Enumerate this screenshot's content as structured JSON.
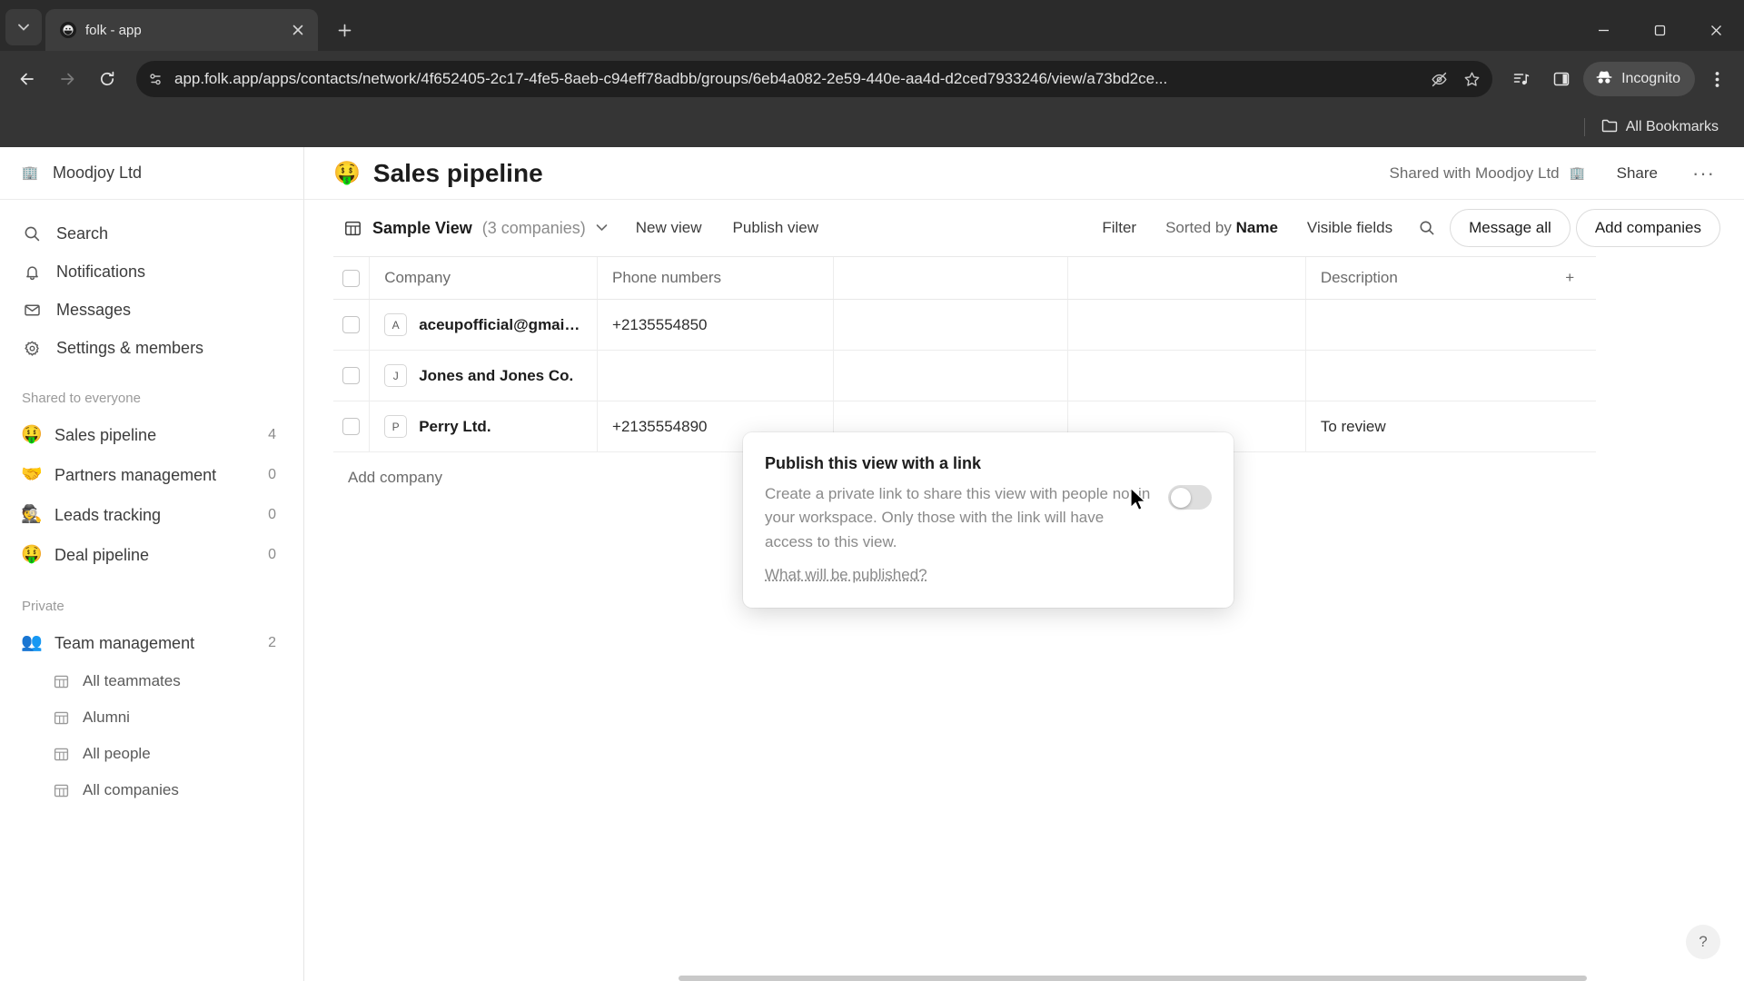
{
  "browser": {
    "tab": {
      "title": "folk - app",
      "favicon": "folk-favicon-icon",
      "close_label": "×"
    },
    "new_tab_label": "+",
    "window": {
      "minimize": "—",
      "maximize": "❐",
      "close": "✕"
    },
    "nav": {
      "back": "←",
      "forward": "→",
      "reload": "↻"
    },
    "omnibox": {
      "url": "app.folk.app/apps/contacts/network/4f652405-2c17-4fe5-8aeb-c94eff78adbb/groups/6eb4a082-2e59-440e-aa4d-d2ced7933246/view/a73bd2ce...",
      "site_info_icon": "tune-icon",
      "tracking_icon": "eye-off-icon",
      "bookmark_icon": "star-icon"
    },
    "toolbar_icons": {
      "media": "media-control-icon",
      "side_panel": "side-panel-icon",
      "menu": "kebab-menu-icon"
    },
    "incognito": {
      "label": "Incognito",
      "icon": "incognito-hat-icon"
    },
    "bookmarks": {
      "all_label": "All Bookmarks",
      "folder_icon": "folder-icon"
    }
  },
  "sidebar": {
    "workspace": {
      "name": "Moodjoy Ltd",
      "avatar": "🏢"
    },
    "nav": [
      {
        "label": "Search",
        "icon": "search-icon"
      },
      {
        "label": "Notifications",
        "icon": "bell-icon"
      },
      {
        "label": "Messages",
        "icon": "envelope-icon"
      },
      {
        "label": "Settings & members",
        "icon": "gear-icon"
      }
    ],
    "shared_group_label": "Shared to everyone",
    "shared_items": [
      {
        "label": "Sales pipeline",
        "emoji": "🤑",
        "count": "4"
      },
      {
        "label": "Partners management",
        "emoji": "🤝",
        "count": "0"
      },
      {
        "label": "Leads tracking",
        "emoji": "🕵️",
        "count": "0"
      },
      {
        "label": "Deal pipeline",
        "emoji": "🤑",
        "count": "0"
      }
    ],
    "private_group_label": "Private",
    "private_items": [
      {
        "label": "Team management",
        "emoji": "👥",
        "count": "2"
      }
    ],
    "sub_items": [
      {
        "label": "All teammates",
        "icon": "table-view-icon"
      },
      {
        "label": "Alumni",
        "icon": "table-view-icon"
      },
      {
        "label": "All people",
        "icon": "table-view-icon"
      },
      {
        "label": "All companies",
        "icon": "table-view-icon"
      }
    ]
  },
  "page": {
    "title": "Sales pipeline",
    "emoji": "🤑",
    "shared_with": "Shared with Moodjoy Ltd",
    "shared_avatar": "🏢",
    "share_label": "Share",
    "more_label": "···"
  },
  "toolbar": {
    "view_icon": "table-view-icon",
    "view_name": "Sample View",
    "view_count": "(3 companies)",
    "view_chevron": "chevron-down-icon",
    "new_view_label": "New view",
    "publish_view_label": "Publish view",
    "filter_label": "Filter",
    "sorted_by_prefix": "Sorted by",
    "sorted_by_field": "Name",
    "visible_fields_label": "Visible fields",
    "search_icon": "search-icon",
    "message_all_label": "Message all",
    "add_companies_label": "Add companies"
  },
  "table": {
    "columns": [
      "Company",
      "Phone numbers",
      "",
      "",
      "Description"
    ],
    "add_column_label": "+",
    "rows": [
      {
        "badge": "A",
        "company": "aceupofficial@gmail.c...",
        "phone": "+2135554850",
        "c": "",
        "d": "",
        "description": ""
      },
      {
        "badge": "J",
        "company": "Jones and Jones Co.",
        "phone": "",
        "c": "",
        "d": "",
        "description": ""
      },
      {
        "badge": "P",
        "company": "Perry Ltd.",
        "phone": "+2135554890",
        "c": "",
        "d": "",
        "description": "To review"
      }
    ],
    "add_row_label": "Add company"
  },
  "popover": {
    "title": "Publish this view with a link",
    "description": "Create a private link to share this view with people not in your workspace. Only those with the link will have access to this view.",
    "link_label": "What will be published?",
    "toggle_state": "off"
  },
  "help": {
    "label": "?"
  },
  "colors": {
    "accent": "#1c1c1c",
    "muted": "#8a8a8a",
    "chrome_bg": "#353535",
    "toggle_off": "#dedede"
  }
}
